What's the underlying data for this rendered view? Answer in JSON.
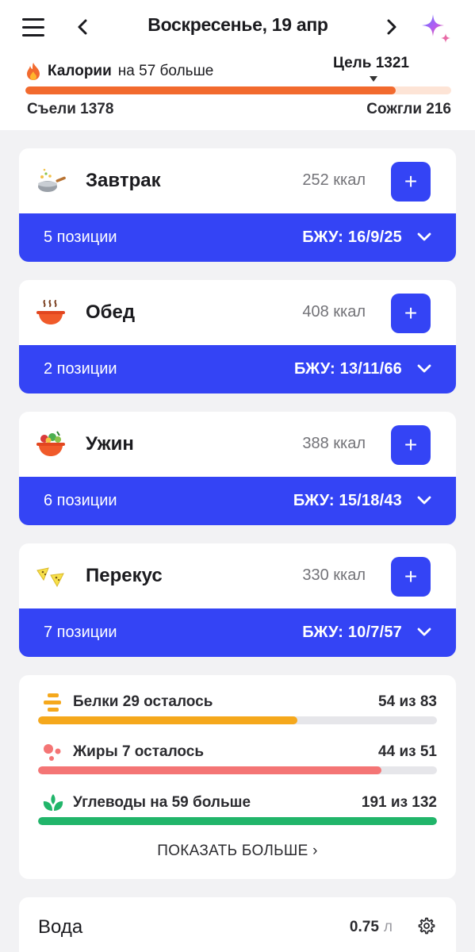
{
  "header": {
    "date": "Воскресенье, 19 апр",
    "menu_icon": "hamburger-menu-icon",
    "prev_icon": "chevron-left-icon",
    "next_icon": "chevron-right-icon",
    "ai_icon": "sparkle-icon"
  },
  "calories": {
    "label_bold": "Калории",
    "label_rest": "на 57 больше",
    "goal": "Цель 1321",
    "eaten": "Съели 1378",
    "burned": "Сожгли 216",
    "progress_fraction": 0.87,
    "accent": "#f26a2e"
  },
  "meals": [
    {
      "name": "Завтрак",
      "kcal": "252 ккал",
      "items": "5 позиции",
      "bju": "БЖУ: 16/9/25",
      "icon": "wok-pan-icon"
    },
    {
      "name": "Обед",
      "kcal": "408 ккал",
      "items": "2 позиции",
      "bju": "БЖУ: 13/11/66",
      "icon": "soup-bowl-icon"
    },
    {
      "name": "Ужин",
      "kcal": "388 ккал",
      "items": "6 позиции",
      "bju": "БЖУ: 15/18/43",
      "icon": "salad-bowl-icon"
    },
    {
      "name": "Перекус",
      "kcal": "330 ккал",
      "items": "7 позиции",
      "bju": "БЖУ: 10/7/57",
      "icon": "nachos-icon"
    }
  ],
  "add_label": "+",
  "macros": [
    {
      "label": "Белки 29 осталось",
      "value": "54 из 83",
      "fraction": 0.65,
      "color": "#f5a81c",
      "icon": "protein-bars-icon"
    },
    {
      "label": "Жиры 7 осталось",
      "value": "44 из 51",
      "fraction": 0.86,
      "color": "#f47575",
      "icon": "fat-drops-icon"
    },
    {
      "label": "Углеводы на 59 больше",
      "value": "191 из 132",
      "fraction": 1.0,
      "color": "#21b56a",
      "icon": "sprout-icon"
    }
  ],
  "show_more": "ПОКАЗАТЬ БОЛЬШЕ ›",
  "water": {
    "title": "Вода",
    "value": "0.75",
    "unit": "л",
    "icon": "gear-icon"
  },
  "colors": {
    "primary": "#3444f5",
    "background": "#f2f2f4"
  }
}
